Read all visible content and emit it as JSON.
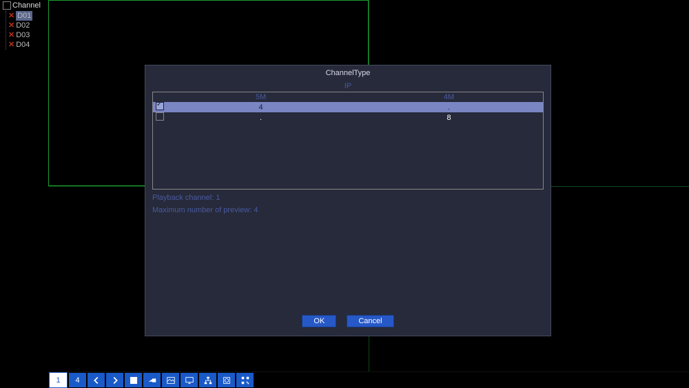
{
  "sidebar": {
    "root": "Channel",
    "items": [
      {
        "label": "D01",
        "selected": true
      },
      {
        "label": "D02",
        "selected": false
      },
      {
        "label": "D03",
        "selected": false
      },
      {
        "label": "D04",
        "selected": false
      }
    ]
  },
  "modal": {
    "title": "ChannelType",
    "ip_header": "IP",
    "columns": [
      "5M",
      "4M"
    ],
    "rows": [
      {
        "checked": true,
        "vals": [
          "4",
          "."
        ]
      },
      {
        "checked": false,
        "vals": [
          ".",
          "8"
        ]
      }
    ],
    "info1": "Playback channel: 1",
    "info2": "Maximum number of preview: 4",
    "ok": "OK",
    "cancel": "Cancel"
  },
  "toolbar": {
    "btn1": "1",
    "btn4": "4"
  }
}
